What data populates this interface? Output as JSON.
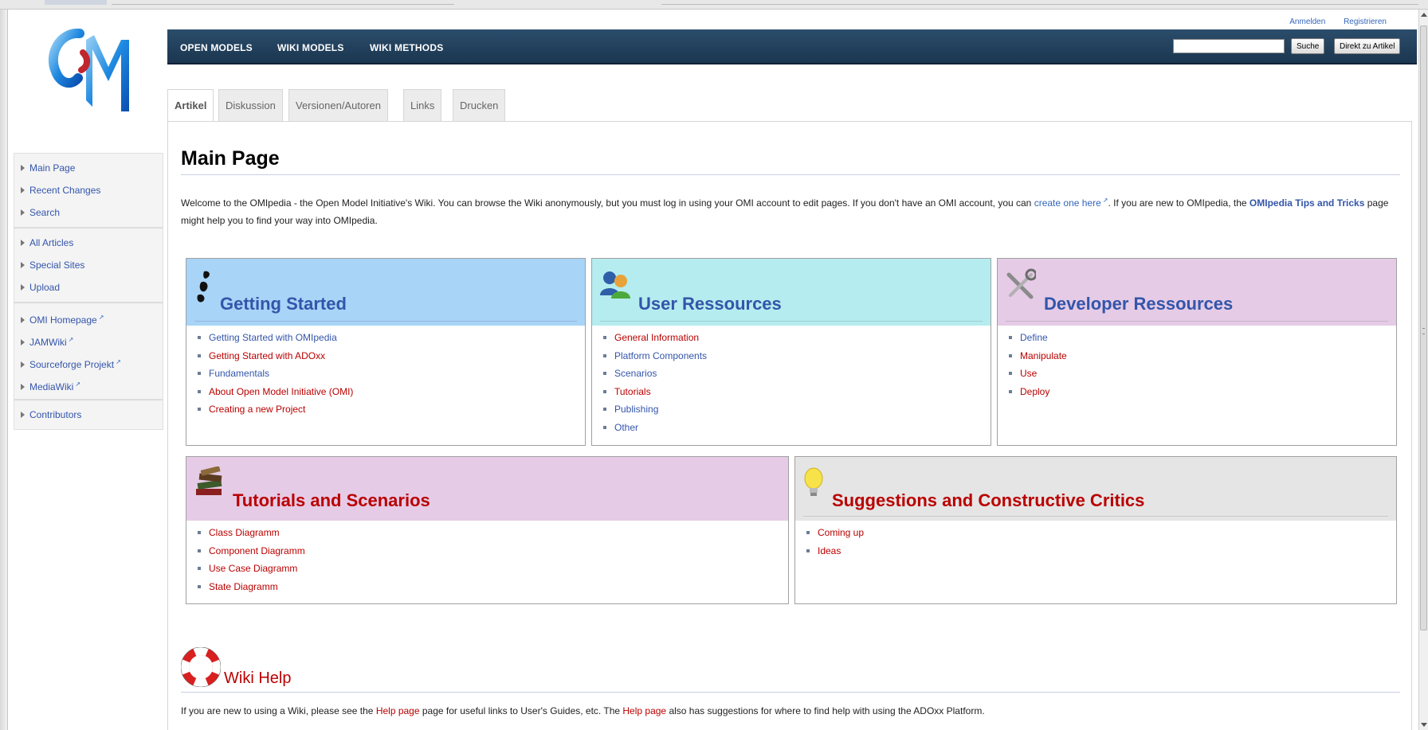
{
  "header": {
    "user_links": {
      "login": "Anmelden",
      "register": "Registrieren"
    },
    "nav": [
      "OPEN MODELS",
      "WIKI MODELS",
      "WIKI METHODS"
    ],
    "search": {
      "placeholder": "",
      "search_button": "Suche",
      "go_button": "Direkt zu Artikel"
    }
  },
  "tabs": [
    "Artikel",
    "Diskussion",
    "Versionen/Autoren",
    "Links",
    "Drucken"
  ],
  "sidebar": {
    "group1": [
      "Main Page",
      "Recent Changes",
      "Search"
    ],
    "group2": [
      "All Articles",
      "Special Sites",
      "Upload"
    ],
    "group3": [
      "OMI Homepage",
      "JAMWiki",
      "Sourceforge Projekt",
      "MediaWiki"
    ],
    "group4": [
      "Contributors"
    ]
  },
  "page": {
    "title": "Main Page",
    "intro_part1": "Welcome to the OMIpedia - the Open Model Initiative's Wiki. You can browse the Wiki anonymously, but you must log in using your OMI account to edit pages. If you don't have an OMI account, you can ",
    "intro_link1": "create one here",
    "intro_part2": ". If you are new to OMIpedia, the ",
    "intro_link2": "OMIpedia Tips and Tricks",
    "intro_part3": " page might help you to find your way into OMIpedia."
  },
  "boxes": {
    "getting_started": {
      "title": "Getting Started",
      "color": "#a8d4f7",
      "items": [
        "Getting Started with OMIpedia",
        "Getting Started with ADOxx",
        "Fundamentals",
        "About Open Model Initiative (OMI)",
        "Creating a new Project"
      ]
    },
    "user_resources": {
      "title": "User Ressources",
      "color": "#b5ecef",
      "items": [
        "General Information",
        "Platform Components",
        "Scenarios",
        "Tutorials",
        "Publishing",
        "Other"
      ]
    },
    "developer_resources": {
      "title": "Developer Ressources",
      "color": "#e5cbe6",
      "items": [
        "Define",
        "Manipulate",
        "Use",
        "Deploy"
      ]
    },
    "tutorials": {
      "title": "Tutorials and Scenarios",
      "color": "#e5cbe6",
      "items": [
        "Class Diagramm",
        "Component Diagramm",
        "Use Case Diagramm",
        "State Diagramm"
      ]
    },
    "suggestions": {
      "title": "Suggestions and Constructive Critics",
      "color": "#e5e5e5",
      "items": [
        "Coming up",
        "Ideas"
      ]
    }
  },
  "help": {
    "title": "Wiki Help",
    "text1": "If you are new to using a Wiki, please see the ",
    "link1": "Help page",
    "text2": " page for useful links to User's Guides, etc. The ",
    "link2": "Help page",
    "text3": " also has suggestions for where to find help with using the ADOxx Platform."
  }
}
